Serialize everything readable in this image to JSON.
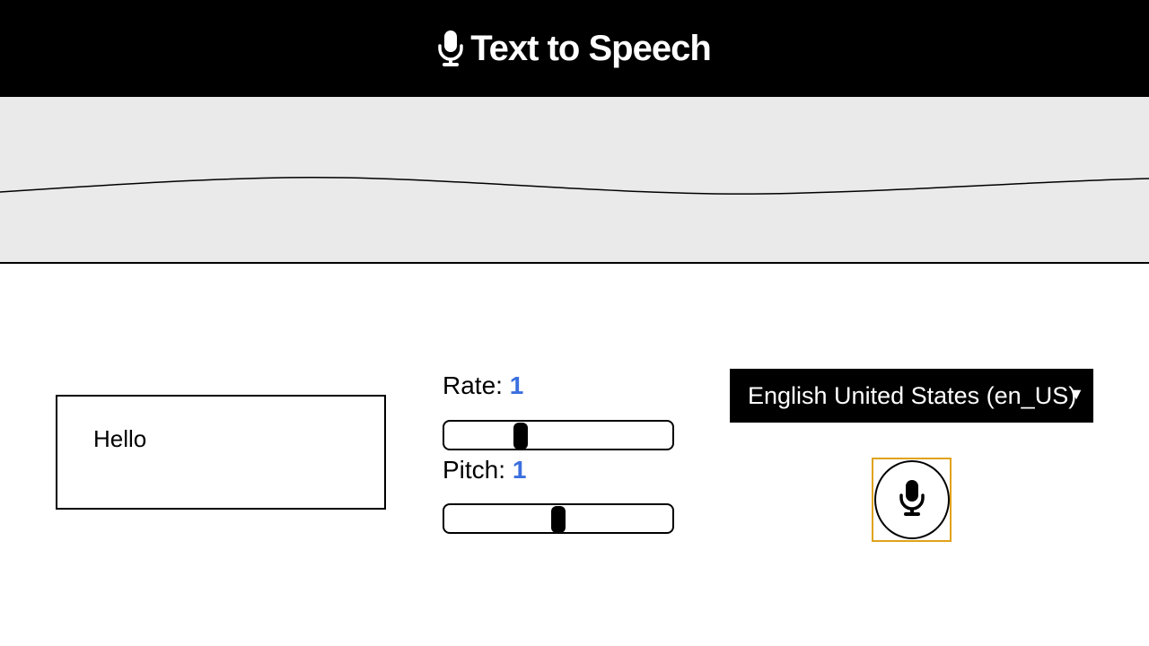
{
  "header": {
    "title": "Text to Speech",
    "icon": "microphone-icon"
  },
  "text_input": {
    "value": "Hello"
  },
  "rate": {
    "label": "Rate: ",
    "value": "1",
    "min": 0.5,
    "max": 2
  },
  "pitch": {
    "label": "Pitch: ",
    "value": "1",
    "min": 0,
    "max": 2
  },
  "language_select": {
    "selected": "English United States (en_US)",
    "caret": "▼"
  },
  "speak_button": {
    "icon": "microphone-icon"
  },
  "colors": {
    "header_bg": "#000000",
    "wave_bg": "#eaeaea",
    "value_accent": "#3b6fe0",
    "button_focus": "#e0a21a"
  }
}
